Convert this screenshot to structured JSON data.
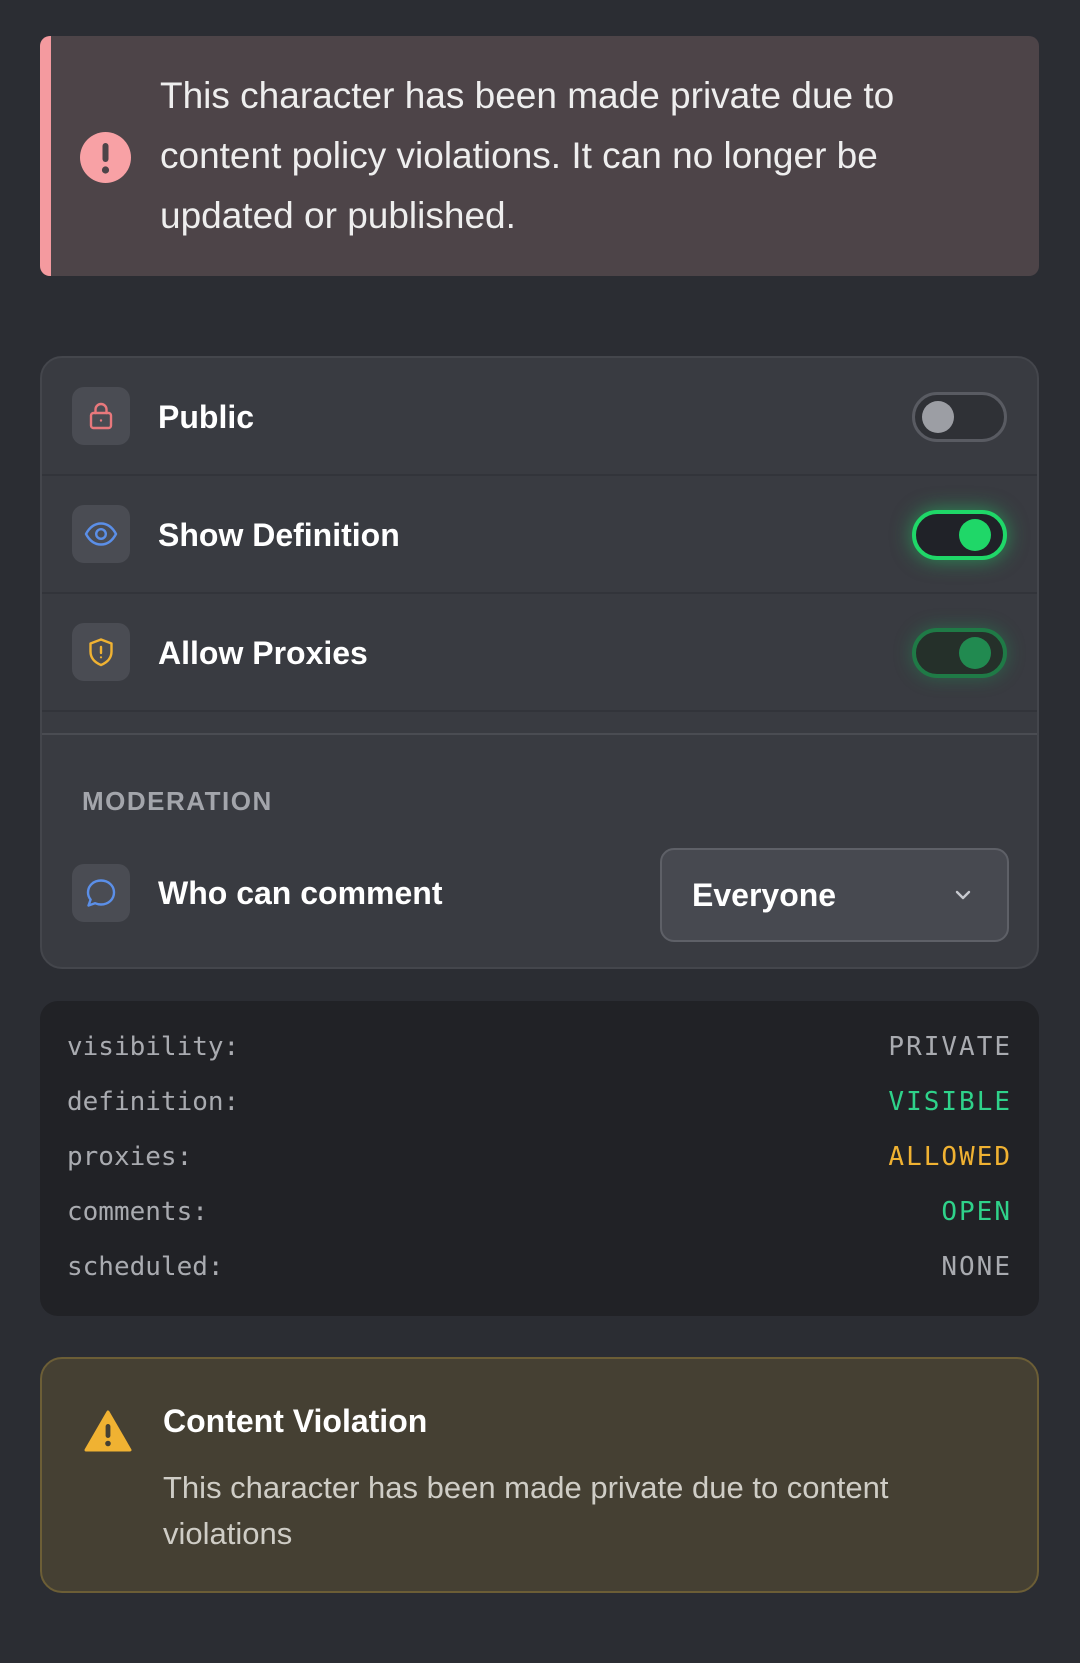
{
  "alert": {
    "message": "This character has been made private due to content policy violations. It can no longer be updated or published.",
    "icon": "exclamation-circle-icon",
    "accent_color": "#f49a9f"
  },
  "settings": {
    "rows": [
      {
        "label": "Public",
        "icon": "lock-icon",
        "icon_color": "#e8787c",
        "state": "off"
      },
      {
        "label": "Show Definition",
        "icon": "eye-icon",
        "icon_color": "#5b8fe8",
        "state": "on"
      },
      {
        "label": "Allow Proxies",
        "icon": "shield-alert-icon",
        "icon_color": "#f0b232",
        "state": "on"
      }
    ],
    "moderation": {
      "section_title": "MODERATION",
      "comment_label": "Who can comment",
      "comment_icon": "message-circle-icon",
      "comment_value": "Everyone"
    },
    "toggle_on_color": "#1fd768"
  },
  "status": {
    "rows": [
      {
        "key": "visibility:",
        "value": "PRIVATE",
        "color": "#a9abb0"
      },
      {
        "key": "definition:",
        "value": "VISIBLE",
        "color": "#2fd28a"
      },
      {
        "key": "proxies:",
        "value": "ALLOWED",
        "color": "#f0b232"
      },
      {
        "key": "comments:",
        "value": "OPEN",
        "color": "#2fd28a"
      },
      {
        "key": "scheduled:",
        "value": "NONE",
        "color": "#a9abb0"
      }
    ]
  },
  "violation": {
    "title": "Content Violation",
    "body": "This character has been made private due to content violations",
    "icon": "warning-triangle-icon",
    "accent_color": "#f0b232"
  }
}
